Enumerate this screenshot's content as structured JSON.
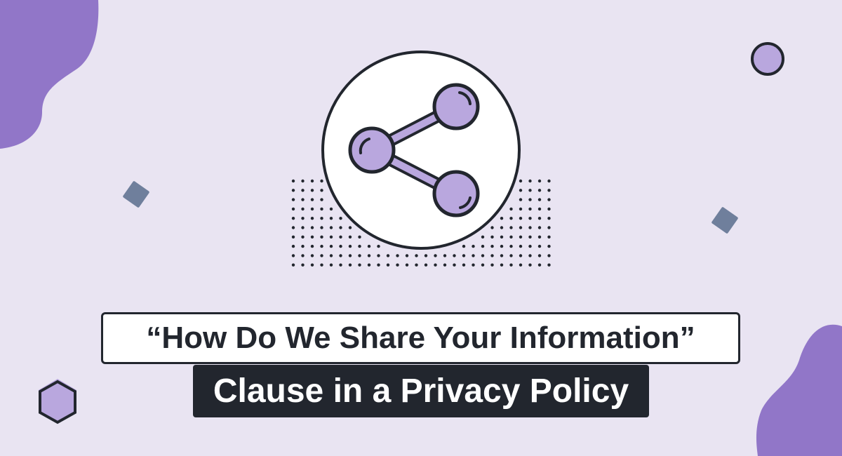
{
  "heading": {
    "line1": "“How Do We Share Your Information”",
    "line2": "Clause in a Privacy Policy"
  },
  "icon": "share-icon",
  "colors": {
    "background": "#e9e4f2",
    "accent_purple": "#9176c8",
    "node_fill": "#b9a7de",
    "dark": "#22262e",
    "slate": "#6f7f9c",
    "white": "#ffffff"
  }
}
